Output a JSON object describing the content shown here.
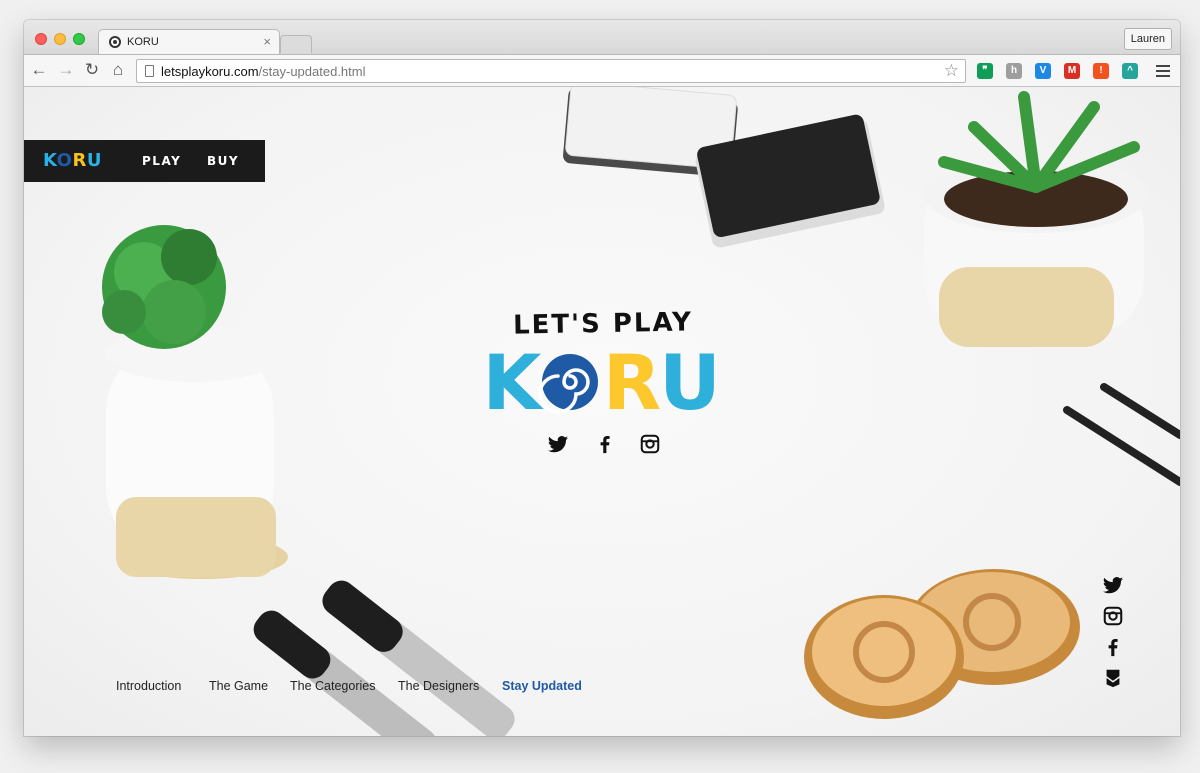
{
  "browser": {
    "tab_title": "KORU",
    "tab_close": "×",
    "profile_name": "Lauren",
    "url_host": "letsplaykoru.com",
    "url_path": "/stay-updated.html",
    "back_glyph": "←",
    "forward_glyph": "→",
    "reload_glyph": "↻",
    "home_glyph": "⌂",
    "star_glyph": "☆",
    "extensions": [
      {
        "name": "hangouts-extension-icon",
        "color": "#0f9d58",
        "glyph": "❞"
      },
      {
        "name": "grey-extension-icon",
        "color": "#9e9e9e",
        "glyph": "h"
      },
      {
        "name": "v-extension-icon",
        "color": "#1e88e5",
        "glyph": "V"
      },
      {
        "name": "gmail-extension-icon",
        "color": "#d93025",
        "glyph": "M"
      },
      {
        "name": "alert-extension-icon",
        "color": "#f4511e",
        "glyph": "!"
      },
      {
        "name": "rainbow-extension-icon",
        "color": "#26a69a",
        "glyph": "^"
      }
    ]
  },
  "site": {
    "nav": {
      "logo_letters": [
        {
          "char": "K",
          "color": "#29b2e6"
        },
        {
          "char": "O",
          "color": "#1f5aa6"
        },
        {
          "char": "R",
          "color": "#f7c31d"
        },
        {
          "char": "U",
          "color": "#29b2e6"
        }
      ],
      "links": [
        "PLAY",
        "BUY"
      ]
    },
    "hero": {
      "subtitle": "LET'S PLAY",
      "logo_letters": [
        {
          "char": "K",
          "color": "#2fb0da"
        },
        {
          "char": "O",
          "color": "#1f5aa6"
        },
        {
          "char": "R",
          "color": "#fcc82e"
        },
        {
          "char": "U",
          "color": "#2fb0da"
        }
      ]
    },
    "hero_social": [
      "twitter-icon",
      "facebook-icon",
      "instagram-icon"
    ],
    "bottom_nav": [
      {
        "label": "Introduction",
        "active": false
      },
      {
        "label": "The Game",
        "active": false
      },
      {
        "label": "The Categories",
        "active": false
      },
      {
        "label": "The Designers",
        "active": false
      },
      {
        "label": "Stay Updated",
        "active": true
      }
    ],
    "side_social": [
      "twitter-icon",
      "instagram-icon",
      "facebook-icon",
      "bandcamp-icon"
    ]
  }
}
